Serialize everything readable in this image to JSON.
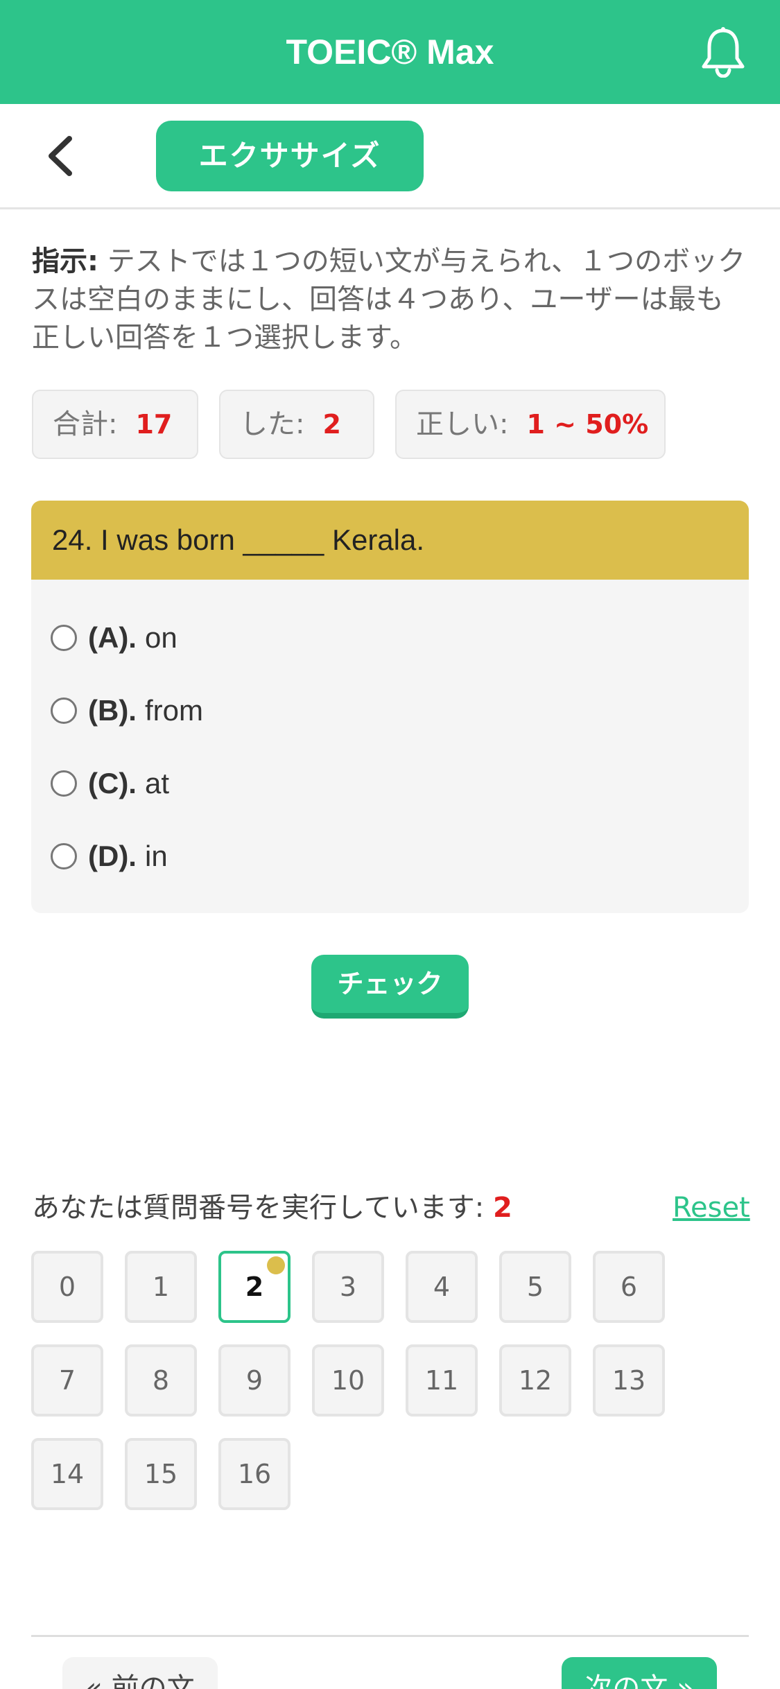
{
  "header": {
    "title": "TOEIC® Max",
    "bell_icon": "bell-icon",
    "brand_color": "#2dc48a"
  },
  "subheader": {
    "back_icon": "chevron-left-icon",
    "mode_label": "エクササイズ"
  },
  "instruction": {
    "label": "指示:",
    "text": " テストでは１つの短い文が与えられ、１つのボックスは空白のままにし、回答は４つあり、ユーザーは最も正しい回答を１つ選択します。"
  },
  "stats": {
    "total_label": "合計:",
    "total_value": "17",
    "done_label": "した:",
    "done_value": "2",
    "correct_label": "正しい:",
    "correct_value": "1 ~ 50%"
  },
  "question": {
    "text": "24. I was born _____ Kerala.",
    "header_color": "#dbbe4c",
    "options": [
      {
        "letter": "(A).",
        "text": "on"
      },
      {
        "letter": "(B).",
        "text": "from"
      },
      {
        "letter": "(C).",
        "text": "at"
      },
      {
        "letter": "(D).",
        "text": "in"
      }
    ]
  },
  "check_label": "チェック",
  "progress": {
    "label": "あなたは質問番号を実行しています:",
    "current": "2",
    "reset_label": "Reset",
    "numbers": [
      "0",
      "1",
      "2",
      "3",
      "4",
      "5",
      "6",
      "7",
      "8",
      "9",
      "10",
      "11",
      "12",
      "13",
      "14",
      "15",
      "16"
    ]
  },
  "nav": {
    "prev_label": "« 前の文",
    "next_label": "次の文 »"
  }
}
